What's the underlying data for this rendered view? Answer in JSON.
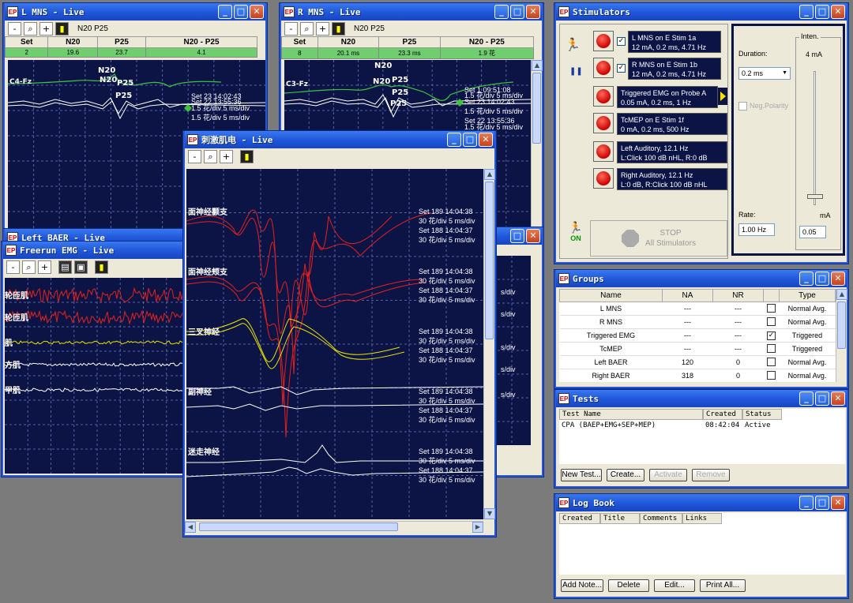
{
  "colors": {
    "trace_bg": "#0c1446",
    "grid": "#5560a6",
    "red": "#e8201c",
    "green": "#3cc33c",
    "yellow": "#e6e200",
    "white": "#ffffff"
  },
  "win_lmns": {
    "title": "L MNS - Live",
    "markers": "N20  P25",
    "columns": [
      "Set",
      "N20",
      "P25",
      "N20 - P25"
    ],
    "row": [
      "2",
      "19.6",
      "23.7",
      "4.1"
    ],
    "channel": "C4-Fz",
    "peak_labels": [
      "N20",
      "N20",
      "P25",
      "P25"
    ],
    "meas": [
      "Set 23 14:02:43",
      "Set 22 13:55:36",
      "1.5 花/div 5 ms/div",
      "1.5 花/div 5 ms/div"
    ]
  },
  "win_rmns": {
    "title": "R MNS - Live",
    "markers": "N20  P25",
    "columns": [
      "Set",
      "N20",
      "P25",
      "N20 - P25"
    ],
    "row": [
      "8",
      "20.1 ms",
      "23.3 ms",
      "1.9 花"
    ],
    "channel": "C3-Fz",
    "peak_labels": [
      "N20",
      "N20",
      "P25",
      "P25",
      "P25"
    ],
    "meas": [
      "Set 1 09:51:08",
      "1.5 花/div 5 ms/div",
      "Set 23 14:02:43",
      "1.5 花/div 5 ms/div",
      "Set 22 13:55:36",
      "1.5 花/div 5 ms/div"
    ]
  },
  "win_baer": {
    "title": "Left BAER - Live"
  },
  "win_freerun": {
    "title": "Freerun EMG - Live",
    "channels": [
      "轮匝肌",
      "轮匝肌",
      "肌",
      "方肌",
      "甲肌"
    ]
  },
  "win_hidden": {
    "meas": [
      "s/div",
      "s/div",
      "s/div",
      "s/div",
      "s/div"
    ]
  },
  "win_temg": {
    "title": "刺激肌电 - Live",
    "channels": [
      {
        "label": "面神经颧支",
        "meas": [
          "Set 189 14:04:38",
          "30 花/div 5 ms/div",
          "Set 188 14:04:37",
          "30 花/div 5 ms/div"
        ]
      },
      {
        "label": "面神经颊支",
        "meas": [
          "Set 189 14:04:38",
          "30 花/div 5 ms/div",
          "Set 188 14:04:37",
          "30 花/div 5 ms/div"
        ]
      },
      {
        "label": "三叉神经",
        "meas": [
          "Set 189 14:04:38",
          "30 花/div 5 ms/div",
          "Set 188 14:04:37",
          "30 花/div 5 ms/div"
        ]
      },
      {
        "label": "副神经",
        "meas": [
          "Set 189 14:04:38",
          "30 花/div 5 ms/div",
          "Set 188 14:04:37",
          "30 花/div 5 ms/div"
        ]
      },
      {
        "label": "迷走神经",
        "meas": [
          "Set 189 14:04:38",
          "30 花/div 5 ms/div",
          "Set 188 14:04:37",
          "30 花/div 5 ms/div"
        ]
      }
    ]
  },
  "stimulators": {
    "title": "Stimulators",
    "items": [
      {
        "line1": "L MNS on E Stim 1a",
        "line2": "12 mA, 0.2 ms, 4.71 Hz",
        "checked": true
      },
      {
        "line1": "R MNS on E Stim 1b",
        "line2": "12 mA, 0.2 ms, 4.71 Hz",
        "checked": true
      },
      {
        "line1": "Triggered EMG on Probe A",
        "line2": "0.05 mA, 0.2 ms, 1 Hz"
      },
      {
        "line1": "TcMEP on E Stim 1f",
        "line2": "0 mA, 0.2 ms, 500 Hz"
      },
      {
        "line1": "Left Auditory, 12.1 Hz",
        "line2": "L:Click 100 dB nHL, R:0 dB"
      },
      {
        "line1": "Right Auditory, 12.1 Hz",
        "line2": "L:0 dB, R:Click 100 dB nHL"
      }
    ],
    "on_label": "ON",
    "stop_line1": "STOP",
    "stop_line2": "All Stimulators",
    "duration_label": "Duration:",
    "duration_value": "0.2 ms",
    "neg_polarity": "Neg.Polarity",
    "rate_label": "Rate:",
    "rate_value": "1.00 Hz",
    "inten_label": "Inten.",
    "inten_value": "4 mA",
    "ma_label": "mA",
    "ma_value": "0.05",
    "slider_level": 0.05
  },
  "groups": {
    "title": "Groups",
    "columns": [
      "Name",
      "NA",
      "NR",
      "",
      "Type"
    ],
    "rows": [
      {
        "name": "L MNS",
        "na": "---",
        "nr": "---",
        "chk": "",
        "type": "Normal Avg."
      },
      {
        "name": "R MNS",
        "na": "---",
        "nr": "---",
        "chk": "",
        "type": "Normal Avg."
      },
      {
        "name": "Triggered EMG",
        "na": "---",
        "nr": "---",
        "chk": "✓",
        "type": "Triggered"
      },
      {
        "name": "TcMEP",
        "na": "---",
        "nr": "---",
        "chk": "",
        "type": "Triggered"
      },
      {
        "name": "Left BAER",
        "na": "120",
        "nr": "0",
        "chk": "",
        "type": "Normal Avg."
      },
      {
        "name": "Right BAER",
        "na": "318",
        "nr": "0",
        "chk": "",
        "type": "Normal Avg."
      }
    ]
  },
  "tests": {
    "title": "Tests",
    "columns": [
      "Test Name",
      "Created",
      "Status"
    ],
    "rows": [
      {
        "name": "CPA (BAEP+EMG+SEP+MEP)",
        "created": "08:42:04",
        "status": "Active"
      }
    ],
    "buttons": [
      "New Test...",
      "Create...",
      "Activate",
      "Remove"
    ]
  },
  "logbook": {
    "title": "Log Book",
    "columns": [
      "Created",
      "Title",
      "Comments",
      "Links"
    ],
    "buttons": [
      "Add Note...",
      "Delete",
      "Edit...",
      "Print All..."
    ]
  }
}
